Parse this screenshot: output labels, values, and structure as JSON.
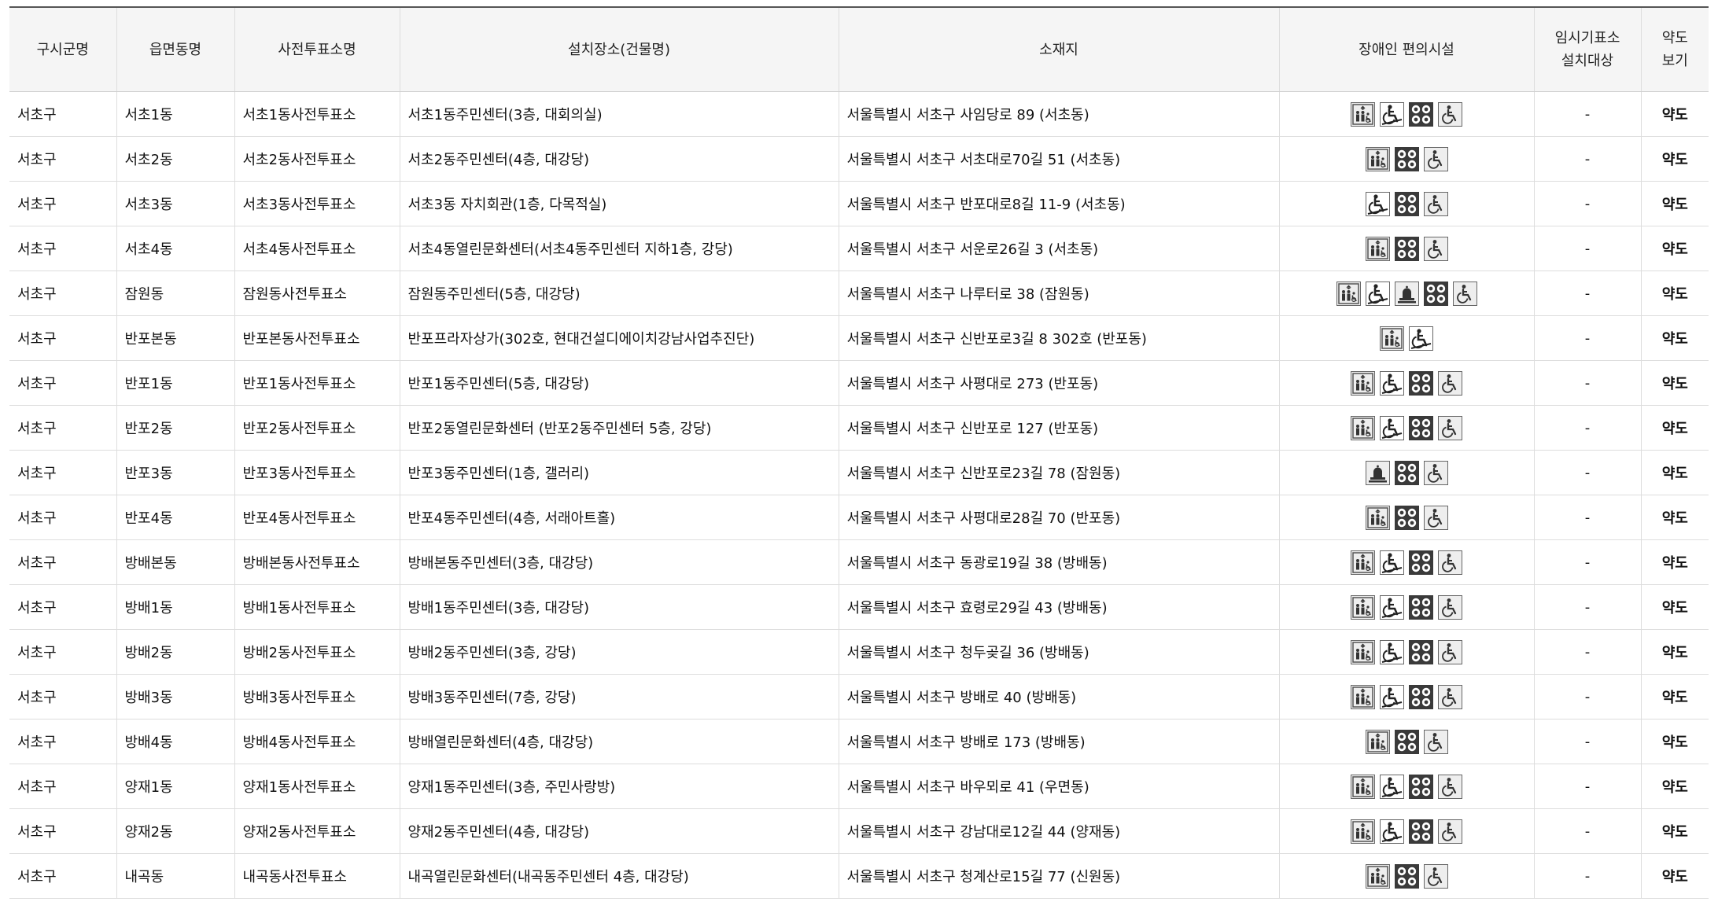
{
  "headers": {
    "sigungu": "구시군명",
    "eupmyeondong": "읍면동명",
    "station": "사전투표소명",
    "location": "설치장소(건물명)",
    "address": "소재지",
    "facilities": "장애인 편의시설",
    "temp_line1": "임시기표소",
    "temp_line2": "설치대상",
    "map_line1": "약도",
    "map_line2": "보기"
  },
  "icon_names": {
    "elevator": "elevator-icon",
    "ramp": "wheelchair-ramp-icon",
    "bell": "call-bell-icon",
    "parking": "accessible-parking-icon",
    "wheelchair": "wheelchair-icon"
  },
  "colors": {
    "header_bg": "#f5f5f5",
    "border": "#dddddd",
    "top_border": "#555555",
    "icon_dark": "#3a3a3a"
  },
  "rows": [
    {
      "sigungu": "서초구",
      "dong": "서초1동",
      "station": "서초1동사전투표소",
      "location": "서초1동주민센터(3층, 대회의실)",
      "address": "서울특별시 서초구 사임당로 89 (서초동)",
      "icons": [
        "elevator",
        "ramp",
        "parking",
        "wheelchair"
      ],
      "temp": "-",
      "map": "약도"
    },
    {
      "sigungu": "서초구",
      "dong": "서초2동",
      "station": "서초2동사전투표소",
      "location": "서초2동주민센터(4층, 대강당)",
      "address": "서울특별시 서초구 서초대로70길 51 (서초동)",
      "icons": [
        "elevator",
        "parking",
        "wheelchair"
      ],
      "temp": "-",
      "map": "약도"
    },
    {
      "sigungu": "서초구",
      "dong": "서초3동",
      "station": "서초3동사전투표소",
      "location": "서초3동 자치회관(1층, 다목적실)",
      "address": "서울특별시 서초구 반포대로8길 11-9 (서초동)",
      "icons": [
        "ramp",
        "parking",
        "wheelchair"
      ],
      "temp": "-",
      "map": "약도"
    },
    {
      "sigungu": "서초구",
      "dong": "서초4동",
      "station": "서초4동사전투표소",
      "location": "서초4동열린문화센터(서초4동주민센터 지하1층, 강당)",
      "address": "서울특별시 서초구 서운로26길 3 (서초동)",
      "icons": [
        "elevator",
        "parking",
        "wheelchair"
      ],
      "temp": "-",
      "map": "약도"
    },
    {
      "sigungu": "서초구",
      "dong": "잠원동",
      "station": "잠원동사전투표소",
      "location": "잠원동주민센터(5층, 대강당)",
      "address": "서울특별시 서초구 나루터로 38 (잠원동)",
      "icons": [
        "elevator",
        "ramp",
        "bell",
        "parking",
        "wheelchair"
      ],
      "temp": "-",
      "map": "약도"
    },
    {
      "sigungu": "서초구",
      "dong": "반포본동",
      "station": "반포본동사전투표소",
      "location": "반포프라자상가(302호, 현대건설디에이치강남사업추진단)",
      "address": "서울특별시 서초구 신반포로3길 8 302호 (반포동)",
      "icons": [
        "elevator",
        "ramp"
      ],
      "temp": "-",
      "map": "약도"
    },
    {
      "sigungu": "서초구",
      "dong": "반포1동",
      "station": "반포1동사전투표소",
      "location": "반포1동주민센터(5층, 대강당)",
      "address": "서울특별시 서초구 사평대로 273 (반포동)",
      "icons": [
        "elevator",
        "ramp",
        "parking",
        "wheelchair"
      ],
      "temp": "-",
      "map": "약도"
    },
    {
      "sigungu": "서초구",
      "dong": "반포2동",
      "station": "반포2동사전투표소",
      "location": "반포2동열린문화센터 (반포2동주민센터 5층, 강당)",
      "address": "서울특별시 서초구 신반포로 127 (반포동)",
      "icons": [
        "elevator",
        "ramp",
        "parking",
        "wheelchair"
      ],
      "temp": "-",
      "map": "약도"
    },
    {
      "sigungu": "서초구",
      "dong": "반포3동",
      "station": "반포3동사전투표소",
      "location": "반포3동주민센터(1층, 갤러리)",
      "address": "서울특별시 서초구 신반포로23길 78 (잠원동)",
      "icons": [
        "bell",
        "parking",
        "wheelchair"
      ],
      "temp": "-",
      "map": "약도"
    },
    {
      "sigungu": "서초구",
      "dong": "반포4동",
      "station": "반포4동사전투표소",
      "location": "반포4동주민센터(4층, 서래아트홀)",
      "address": "서울특별시 서초구 사평대로28길 70 (반포동)",
      "icons": [
        "elevator",
        "parking",
        "wheelchair"
      ],
      "temp": "-",
      "map": "약도"
    },
    {
      "sigungu": "서초구",
      "dong": "방배본동",
      "station": "방배본동사전투표소",
      "location": "방배본동주민센터(3층, 대강당)",
      "address": "서울특별시 서초구 동광로19길 38 (방배동)",
      "icons": [
        "elevator",
        "ramp",
        "parking",
        "wheelchair"
      ],
      "temp": "-",
      "map": "약도"
    },
    {
      "sigungu": "서초구",
      "dong": "방배1동",
      "station": "방배1동사전투표소",
      "location": "방배1동주민센터(3층, 대강당)",
      "address": "서울특별시 서초구 효령로29길 43 (방배동)",
      "icons": [
        "elevator",
        "ramp",
        "parking",
        "wheelchair"
      ],
      "temp": "-",
      "map": "약도"
    },
    {
      "sigungu": "서초구",
      "dong": "방배2동",
      "station": "방배2동사전투표소",
      "location": "방배2동주민센터(3층, 강당)",
      "address": "서울특별시 서초구 청두곶길 36 (방배동)",
      "icons": [
        "elevator",
        "ramp",
        "parking",
        "wheelchair"
      ],
      "temp": "-",
      "map": "약도"
    },
    {
      "sigungu": "서초구",
      "dong": "방배3동",
      "station": "방배3동사전투표소",
      "location": "방배3동주민센터(7층, 강당)",
      "address": "서울특별시 서초구 방배로 40 (방배동)",
      "icons": [
        "elevator",
        "ramp",
        "parking",
        "wheelchair"
      ],
      "temp": "-",
      "map": "약도"
    },
    {
      "sigungu": "서초구",
      "dong": "방배4동",
      "station": "방배4동사전투표소",
      "location": "방배열린문화센터(4층, 대강당)",
      "address": "서울특별시 서초구 방배로 173 (방배동)",
      "icons": [
        "elevator",
        "parking",
        "wheelchair"
      ],
      "temp": "-",
      "map": "약도"
    },
    {
      "sigungu": "서초구",
      "dong": "양재1동",
      "station": "양재1동사전투표소",
      "location": "양재1동주민센터(3층, 주민사랑방)",
      "address": "서울특별시 서초구 바우뫼로 41 (우면동)",
      "icons": [
        "elevator",
        "ramp",
        "parking",
        "wheelchair"
      ],
      "temp": "-",
      "map": "약도"
    },
    {
      "sigungu": "서초구",
      "dong": "양재2동",
      "station": "양재2동사전투표소",
      "location": "양재2동주민센터(4층, 대강당)",
      "address": "서울특별시 서초구 강남대로12길 44 (양재동)",
      "icons": [
        "elevator",
        "ramp",
        "parking",
        "wheelchair"
      ],
      "temp": "-",
      "map": "약도"
    },
    {
      "sigungu": "서초구",
      "dong": "내곡동",
      "station": "내곡동사전투표소",
      "location": "내곡열린문화센터(내곡동주민센터 4층, 대강당)",
      "address": "서울특별시 서초구 청계산로15길 77 (신원동)",
      "icons": [
        "elevator",
        "parking",
        "wheelchair"
      ],
      "temp": "-",
      "map": "약도"
    }
  ]
}
